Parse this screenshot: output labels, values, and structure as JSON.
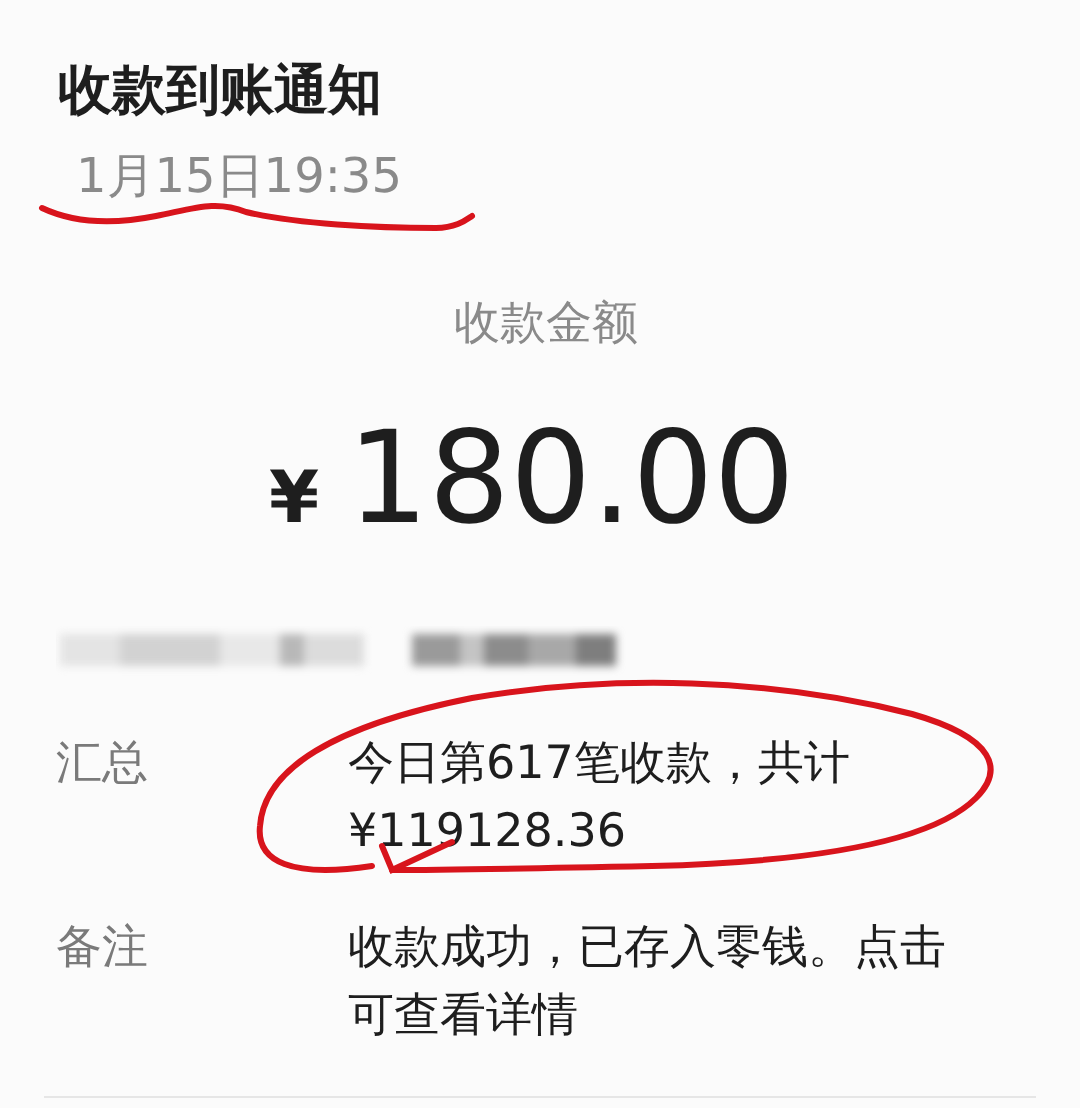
{
  "title": "收款到账通知",
  "time": "1月15日19:35",
  "amount_label": "收款金额",
  "amount": {
    "currency": "¥",
    "value": "180.00"
  },
  "rows": [
    {
      "kind": "redacted"
    },
    {
      "kind": "field",
      "label": "汇总",
      "lines": [
        "今日第617笔收款，共计",
        "¥119128.36"
      ],
      "circled": true
    },
    {
      "kind": "field",
      "label": "备注",
      "lines": [
        "收款成功，已存入零钱。点击",
        "可查看详情"
      ],
      "circled": false
    }
  ]
}
